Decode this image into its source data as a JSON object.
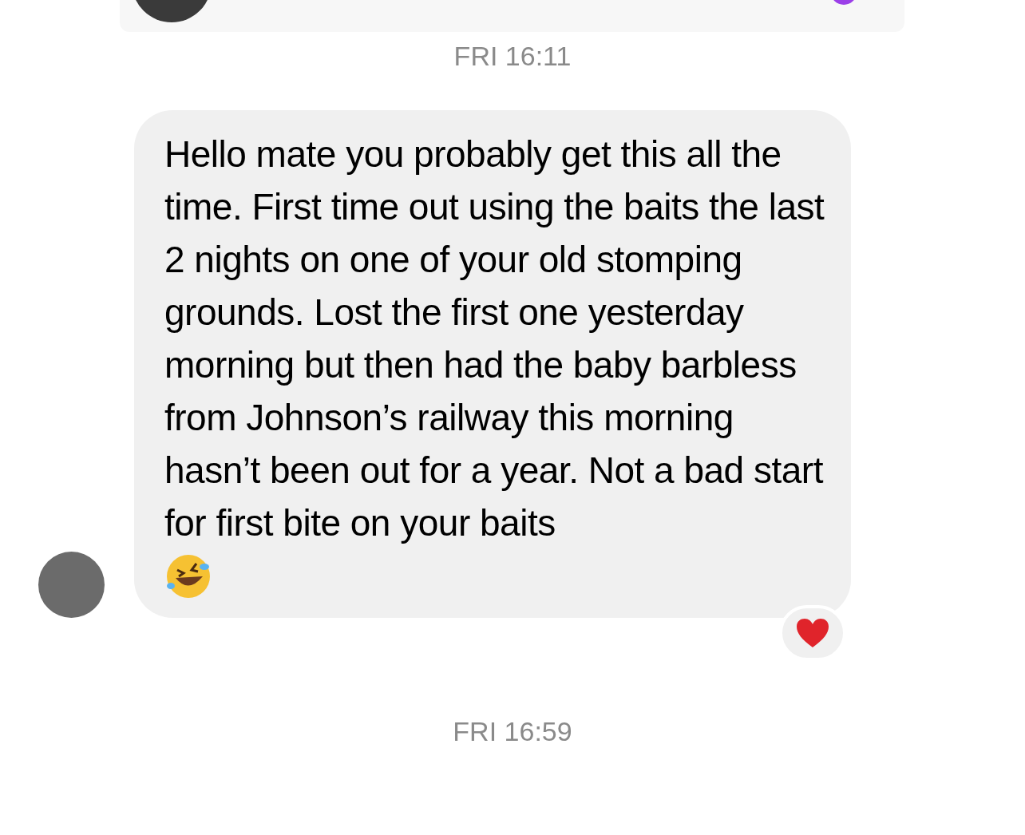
{
  "timestamps": [
    "FRI 16:11",
    "FRI 16:59"
  ],
  "message": {
    "text": "Hello mate you probably get this all the time. First time out using the baits the last 2 nights on one of your old stomping grounds. Lost the first one yesterday morning but then had the baby barbless from Johnson’s railway this morning hasn’t been out for a year. Not a bad start for first bite on your baits"
  }
}
